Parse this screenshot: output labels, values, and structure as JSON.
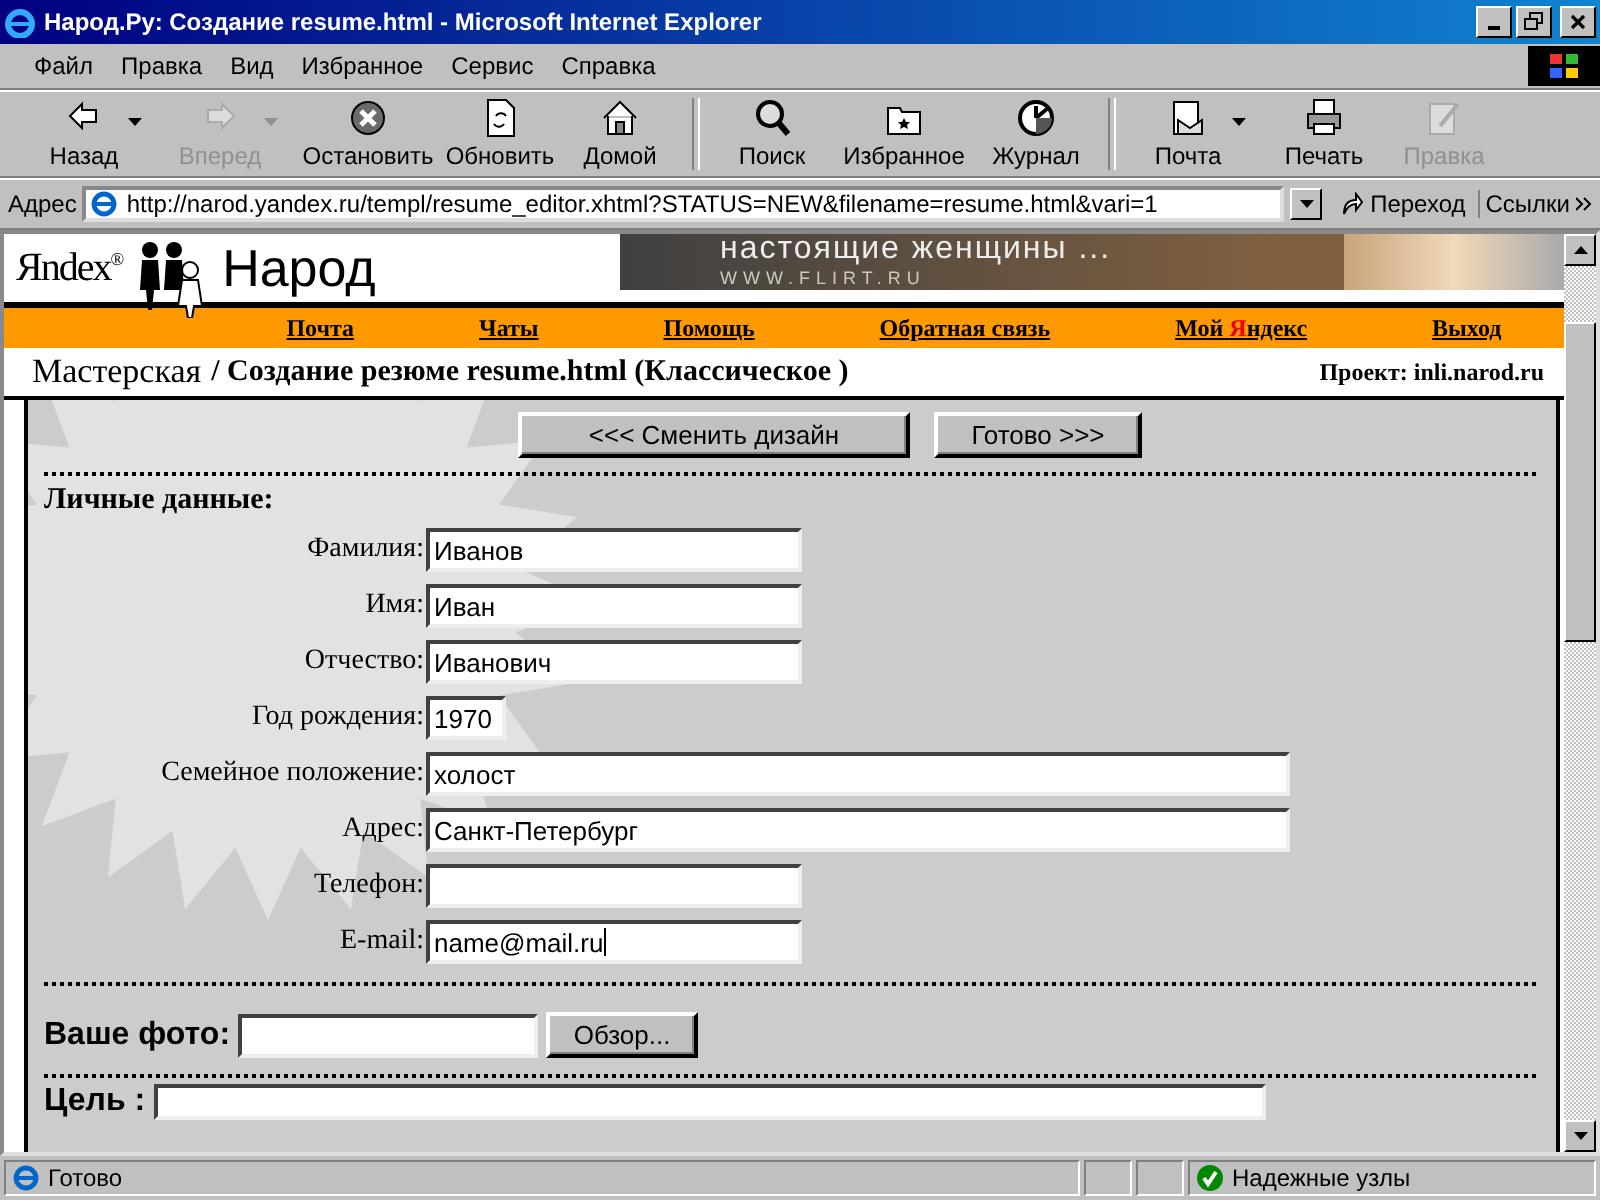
{
  "window": {
    "title": "Народ.Ру: Создание resume.html - Microsoft Internet Explorer"
  },
  "menu": [
    "Файл",
    "Правка",
    "Вид",
    "Избранное",
    "Сервис",
    "Справка"
  ],
  "toolbar": [
    {
      "label": "Назад",
      "kind": "back",
      "disabled": false,
      "dropdown": true,
      "separator_before": false
    },
    {
      "label": "Вперед",
      "kind": "forward",
      "disabled": true,
      "dropdown": true,
      "separator_before": false
    },
    {
      "label": "Остановить",
      "kind": "stop",
      "disabled": false,
      "dropdown": false,
      "separator_before": false
    },
    {
      "label": "Обновить",
      "kind": "refresh",
      "disabled": false,
      "dropdown": false,
      "separator_before": false
    },
    {
      "label": "Домой",
      "kind": "home",
      "disabled": false,
      "dropdown": false,
      "separator_before": false
    },
    {
      "label": "Поиск",
      "kind": "search",
      "disabled": false,
      "dropdown": false,
      "separator_before": true
    },
    {
      "label": "Избранное",
      "kind": "favorites",
      "disabled": false,
      "dropdown": false,
      "separator_before": false
    },
    {
      "label": "Журнал",
      "kind": "history",
      "disabled": false,
      "dropdown": false,
      "separator_before": false
    },
    {
      "label": "Почта",
      "kind": "mail",
      "disabled": false,
      "dropdown": true,
      "separator_before": true
    },
    {
      "label": "Печать",
      "kind": "print",
      "disabled": false,
      "dropdown": false,
      "separator_before": false
    },
    {
      "label": "Правка",
      "kind": "edit",
      "disabled": true,
      "dropdown": false,
      "separator_before": false
    }
  ],
  "address": {
    "label": "Адрес",
    "url": "http://narod.yandex.ru/templ/resume_editor.xhtml?STATUS=NEW&filename=resume.html&vari=1",
    "go": "Переход",
    "links": "Ссылки"
  },
  "header": {
    "brand": "Яndex$^{®}$",
    "site": "Народ",
    "banner_text": "настоящие женщины ...",
    "banner_url": "WWW.FLIRT.RU"
  },
  "nav": [
    {
      "parts": [
        {
          "text": "Почта",
          "accent": false
        }
      ]
    },
    {
      "parts": [
        {
          "text": "Чаты",
          "accent": false
        }
      ]
    },
    {
      "parts": [
        {
          "text": "Помощь",
          "accent": false
        }
      ]
    },
    {
      "parts": [
        {
          "text": "Обратная связь",
          "accent": false
        }
      ]
    },
    {
      "parts": [
        {
          "text": "Мой ",
          "accent": false
        },
        {
          "text": "Я",
          "accent": true
        },
        {
          "text": "ндекс",
          "accent": false
        }
      ]
    },
    {
      "parts": [
        {
          "text": "Выход",
          "accent": false
        }
      ]
    }
  ],
  "breadcrumb": {
    "link": "Мастерская",
    "text": "/ Создание резюме resume.html (Классическое )",
    "project_label": "Проект:",
    "project_link": "inli.narod.ru"
  },
  "buttons": [
    "<<< Сменить дизайн",
    "Готово >>>"
  ],
  "section": "Личные данные:",
  "fields": [
    {
      "label": "Фамилия:",
      "value": "Иванов",
      "kind": "medium",
      "focused": false
    },
    {
      "label": "Имя:",
      "value": "Иван",
      "kind": "medium",
      "focused": false
    },
    {
      "label": "Отчество:",
      "value": "Иванович",
      "kind": "medium",
      "focused": false
    },
    {
      "label": "Год рождения:",
      "value": "1970",
      "kind": "short",
      "focused": false
    },
    {
      "label": "Семейное положение:",
      "value": "холост",
      "kind": "wide",
      "focused": false
    },
    {
      "label": "Адрес:",
      "value": "Санкт-Петербург",
      "kind": "wide",
      "focused": false
    },
    {
      "label": "Телефон:",
      "kind": "medium",
      "focused": false
    },
    {
      "label": "E-mail:",
      "value": "name@mail.ru",
      "kind": "medium",
      "focused": true
    }
  ],
  "photo": {
    "label": "Ваше фото:",
    "browse": "Обзор..."
  },
  "goal": {
    "label": "Цель :"
  },
  "status_bar": {
    "text": "Готово",
    "zone": "Надежные узлы"
  }
}
